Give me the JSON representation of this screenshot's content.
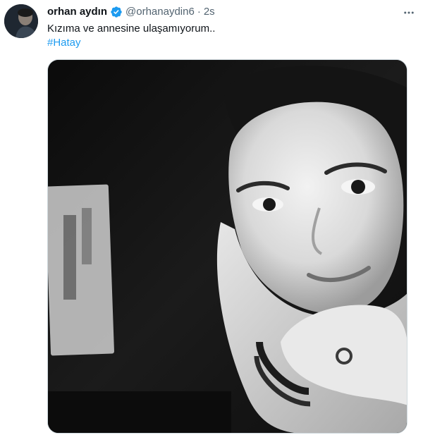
{
  "tweet": {
    "author": {
      "display_name": "orhan aydın",
      "handle": "@orhanaydin6",
      "verified": true,
      "avatar_icon": "user-avatar"
    },
    "separator": "·",
    "timestamp": "2s",
    "more_icon": "more-options-icon",
    "text": "Kızıma ve annesine ulaşamıyorum..",
    "hashtag": "#Hatay",
    "media": {
      "type": "photo",
      "colors": {
        "dark": "#111111",
        "light": "#d8d8d8"
      }
    },
    "colors": {
      "link": "#1d9bf0",
      "secondary": "#536471",
      "verified_badge": "#1d9bf0"
    }
  }
}
